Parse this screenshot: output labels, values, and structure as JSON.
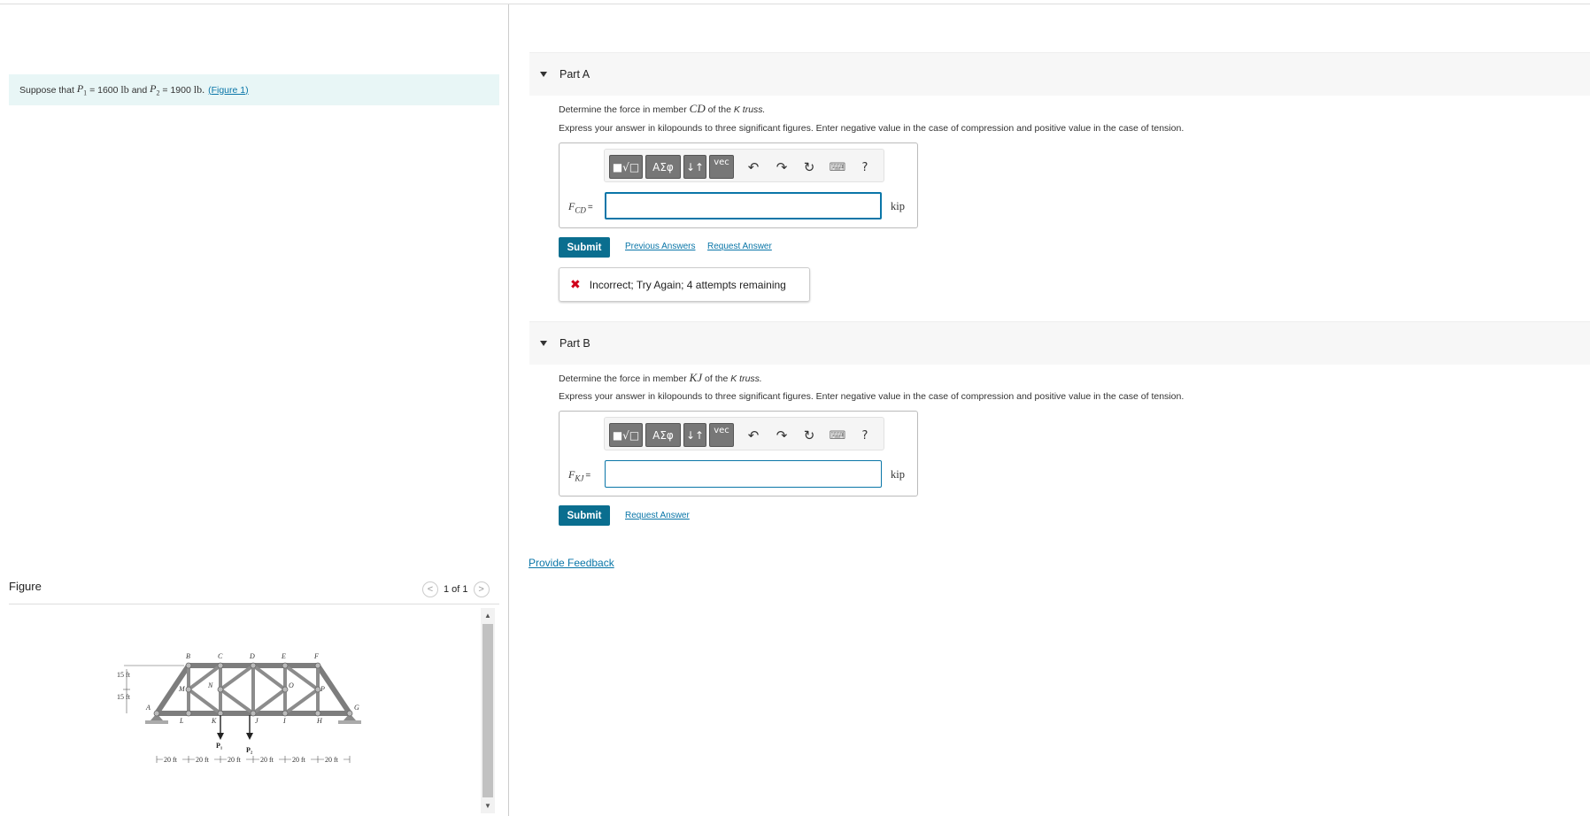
{
  "given": {
    "prefix": "Suppose that",
    "p1_symbol": "P",
    "p1_sub": "1",
    "p1_value": "= 1600",
    "unit1": "lb",
    "and": "and",
    "p2_symbol": "P",
    "p2_sub": "2",
    "p2_value": "= 1900",
    "unit2": "lb.",
    "figure_link": "(Figure 1)"
  },
  "figure": {
    "title": "Figure",
    "pager": "1 of 1",
    "prev": "<",
    "next": ">",
    "labels": {
      "B": "B",
      "C": "C",
      "D": "D",
      "E": "E",
      "F": "F",
      "A": "A",
      "G": "G",
      "M": "M",
      "N": "N",
      "O": "O",
      "P": "P",
      "L": "L",
      "K": "K",
      "J": "J",
      "I": "I",
      "H": "H",
      "h1": "15 ft",
      "h2": "15 ft",
      "load1": "P₁",
      "load2": "P₂",
      "spans": [
        "20 ft",
        "20 ft",
        "20 ft",
        "20 ft",
        "20 ft",
        "20 ft"
      ]
    }
  },
  "toolbar": {
    "templates": "■√□",
    "greek": "ΑΣφ",
    "arrows": "↓↑",
    "vec": "vec",
    "undo": "↶",
    "redo": "↷",
    "reset": "↻",
    "keyboard": "⌨",
    "help": "?"
  },
  "partA": {
    "title": "Part A",
    "question_pre": "Determine the force in member",
    "member": "CD",
    "question_mid": "of the",
    "truss_letter": "K",
    "question_post": "truss.",
    "instructions": "Express your answer in kilopounds to three significant figures. Enter negative value in the case of compression and positive value in the case of tension.",
    "var_symbol": "F",
    "var_sub": "CD",
    "eq": "=",
    "value": "",
    "unit": "kip",
    "submit": "Submit",
    "previous_answers": "Previous Answers",
    "request_answer": "Request Answer",
    "feedback_icon": "✖",
    "feedback": "Incorrect; Try Again; 4 attempts remaining"
  },
  "partB": {
    "title": "Part B",
    "question_pre": "Determine the force in member",
    "member": "KJ",
    "question_mid": "of the",
    "truss_letter": "K",
    "question_post": "truss.",
    "instructions": "Express your answer in kilopounds to three significant figures. Enter negative value in the case of compression and positive value in the case of tension.",
    "var_symbol": "F",
    "var_sub": "KJ",
    "eq": "=",
    "value": "",
    "unit": "kip",
    "submit": "Submit",
    "request_answer": "Request Answer"
  },
  "provide_feedback": "Provide Feedback"
}
